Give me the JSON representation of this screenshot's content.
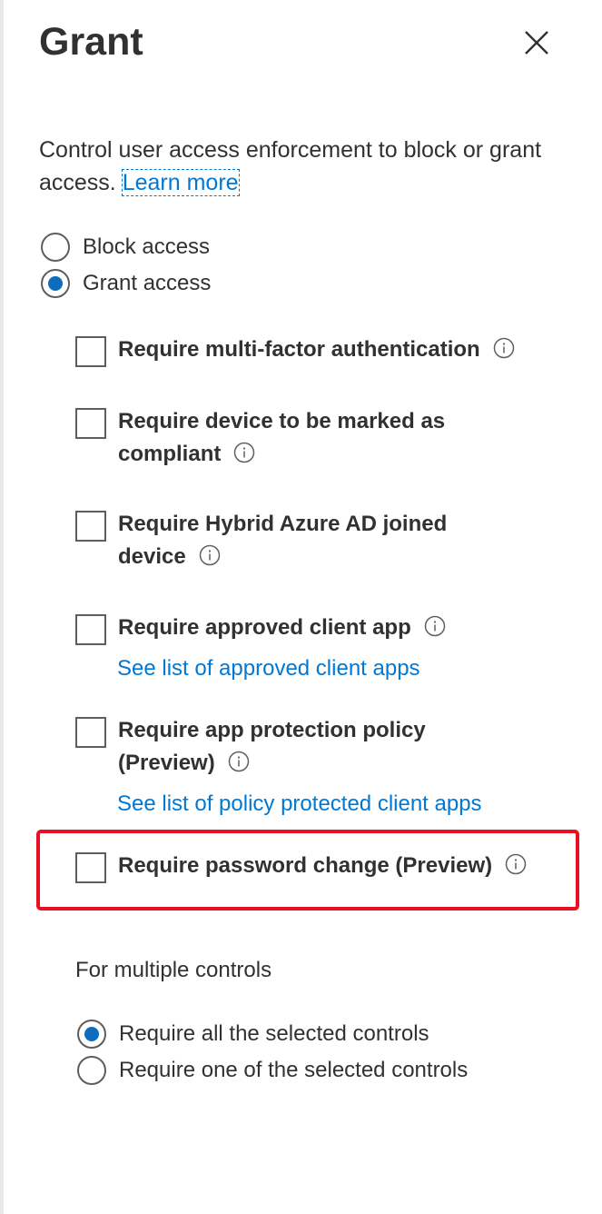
{
  "panel": {
    "title": "Grant",
    "description": "Control user access enforcement to block or grant access.",
    "learn_more": "Learn more"
  },
  "access_options": [
    {
      "label": "Block access",
      "checked": false
    },
    {
      "label": "Grant access",
      "checked": true
    }
  ],
  "grant_controls": [
    {
      "label": "Require multi-factor authentication",
      "checked": false,
      "icon": "info-icon"
    },
    {
      "label_line1": "Require device to be marked as",
      "label_line2": "compliant",
      "checked": false,
      "icon": "info-icon"
    },
    {
      "label_line1": "Require Hybrid Azure AD joined",
      "label_line2": "device",
      "checked": false,
      "icon": "info-icon"
    },
    {
      "label": "Require approved client app",
      "checked": false,
      "icon": "info-icon",
      "link": "See list of approved client apps"
    },
    {
      "label_line1": "Require app protection policy",
      "label_line2": "(Preview)",
      "checked": false,
      "icon": "info-icon",
      "link": "See list of policy protected client apps"
    },
    {
      "label": "Require password change (Preview)",
      "checked": false,
      "icon": "info-icon",
      "highlighted": true
    }
  ],
  "multiple_controls": {
    "label": "For multiple controls",
    "options": [
      {
        "label": "Require all the selected controls",
        "checked": true
      },
      {
        "label": "Require one of the selected controls",
        "checked": false
      }
    ]
  },
  "colors": {
    "accent": "#0078d4",
    "radio_selected": "#0f6cbd",
    "highlight": "#e81123",
    "text": "#323130"
  }
}
